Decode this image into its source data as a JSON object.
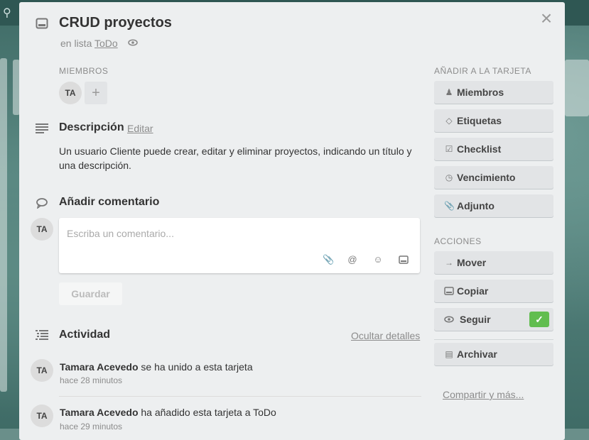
{
  "card": {
    "title": "CRUD proyectos",
    "in_list_prefix": "en lista",
    "list_name": "ToDo"
  },
  "members": {
    "label": "MIEMBROS",
    "avatar_initials": "TA",
    "add_label": "+"
  },
  "description": {
    "title": "Descripción",
    "edit_label": "Editar",
    "text": "Un usuario Cliente puede crear, editar y eliminar proyectos, indicando un título y una descripción."
  },
  "comment": {
    "title": "Añadir comentario",
    "avatar_initials": "TA",
    "placeholder": "Escriba un comentario...",
    "save_label": "Guardar"
  },
  "activity": {
    "title": "Actividad",
    "hide_details_label": "Ocultar detalles",
    "items": [
      {
        "initials": "TA",
        "user": "Tamara Acevedo",
        "action": "se ha unido a esta tarjeta",
        "time": "hace 28 minutos"
      },
      {
        "initials": "TA",
        "user": "Tamara Acevedo",
        "action": "ha añadido esta tarjeta a ToDo",
        "time": "hace 29 minutos"
      }
    ]
  },
  "sidebar": {
    "add_label": "AÑADIR A LA TARJETA",
    "add_buttons": [
      {
        "label": "Miembros",
        "icon": "person-icon"
      },
      {
        "label": "Etiquetas",
        "icon": "tag-icon"
      },
      {
        "label": "Checklist",
        "icon": "checkbox-icon"
      },
      {
        "label": "Vencimiento",
        "icon": "clock-icon"
      },
      {
        "label": "Adjunto",
        "icon": "paperclip-icon"
      }
    ],
    "actions_label": "ACCIONES",
    "action_buttons": [
      {
        "label": "Mover",
        "icon": "arrow-right-icon"
      },
      {
        "label": "Copiar",
        "icon": "card-icon"
      },
      {
        "label": "Seguir",
        "icon": "eye-icon"
      }
    ],
    "archive_label": "Archivar",
    "share_label": "Compartir y más..."
  },
  "colors": {
    "accent_green": "#61bd4f",
    "modal_bg": "#edeff0"
  }
}
